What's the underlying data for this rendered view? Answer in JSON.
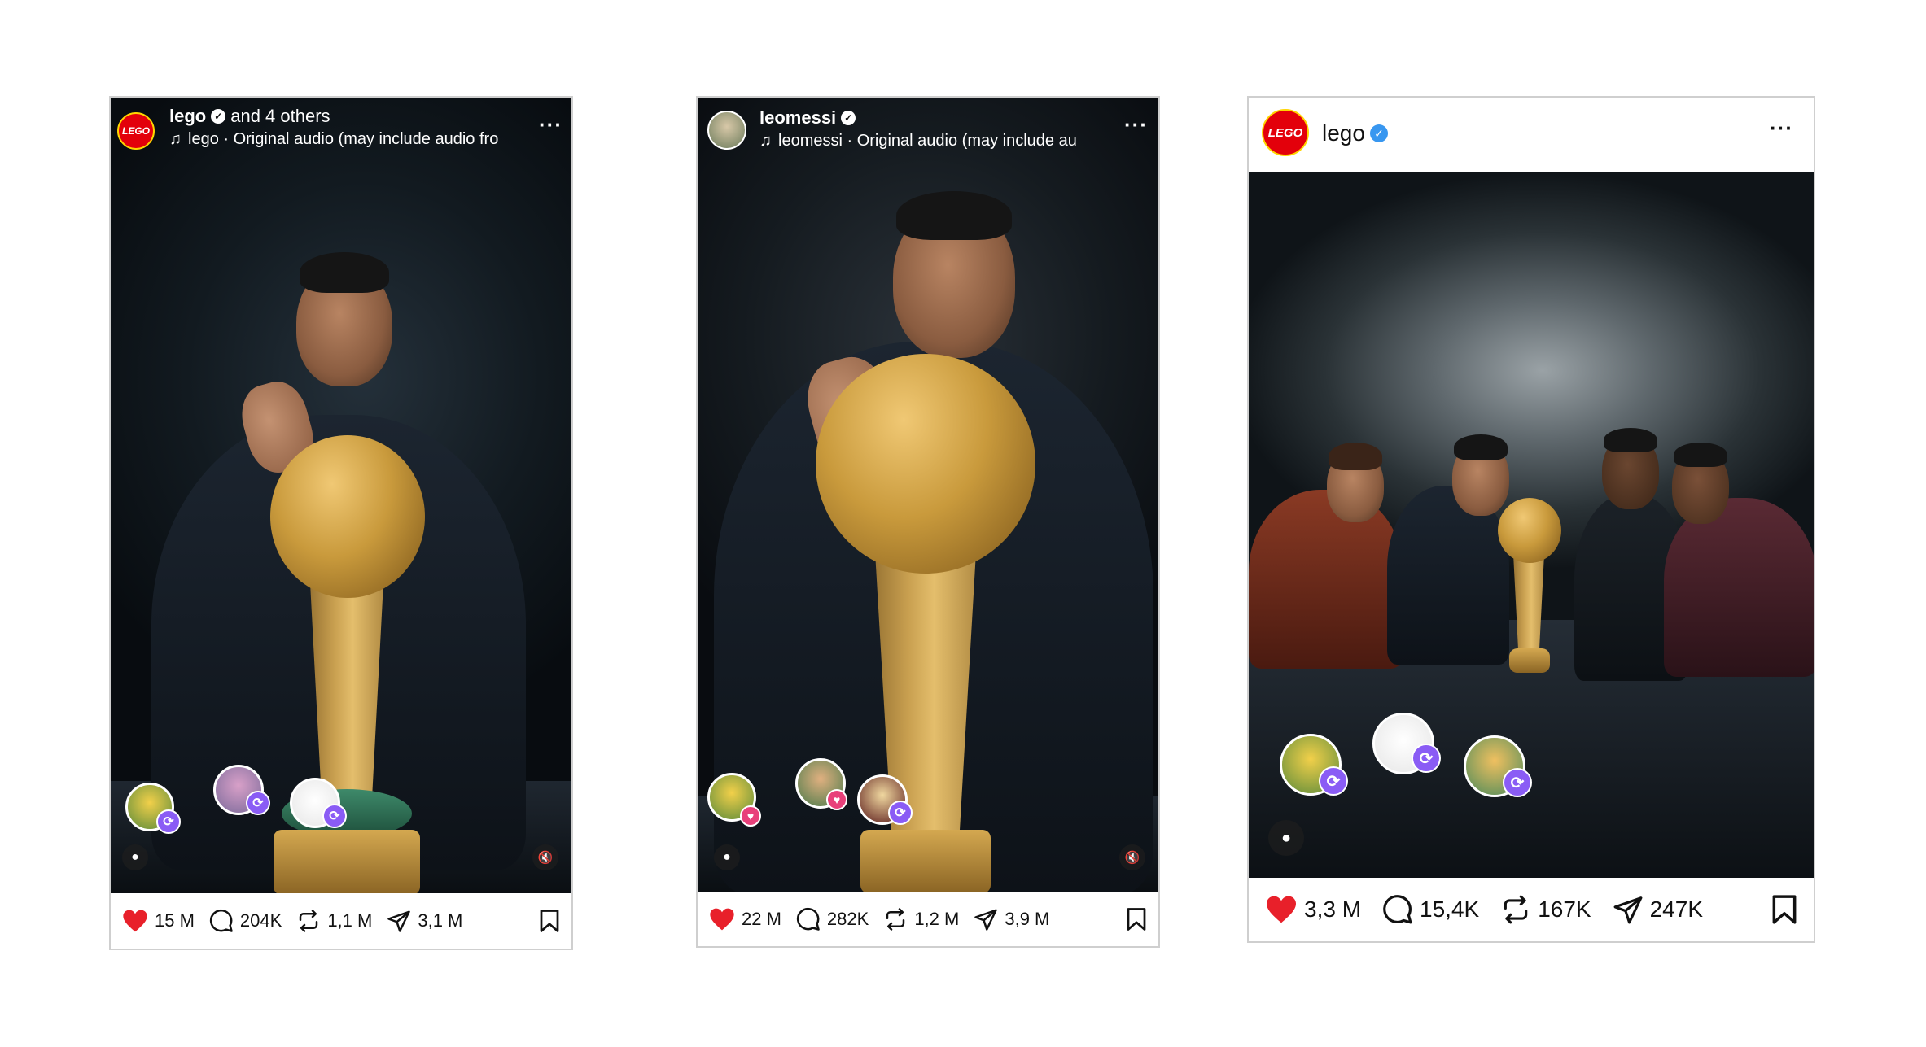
{
  "colors": {
    "like_red": "#e8202a",
    "repost_purple": "#8a5cf5",
    "verified_blue": "#3897f0",
    "lego_red": "#e3000b"
  },
  "posts": [
    {
      "type": "reel",
      "author": "lego",
      "coauthors": "and 4 others",
      "audio": "lego · Original audio  (may include audio fro",
      "more_icon": "ellipsis-icon",
      "stats": {
        "likes": "15 M",
        "comments": "204K",
        "reposts": "1,1 M",
        "shares": "3,1 M"
      }
    },
    {
      "type": "reel",
      "author": "leomessi",
      "coauthors": "",
      "audio": "leomessi · Original audio  (may include au",
      "more_icon": "ellipsis-icon",
      "stats": {
        "likes": "22 M",
        "comments": "282K",
        "reposts": "1,2 M",
        "shares": "3,9 M"
      }
    },
    {
      "type": "photo",
      "author": "lego",
      "more_icon": "ellipsis-icon",
      "stats": {
        "likes": "3,3 M",
        "comments": "15,4K",
        "reposts": "167K",
        "shares": "247K"
      }
    }
  ],
  "logo_text": "LEGO"
}
